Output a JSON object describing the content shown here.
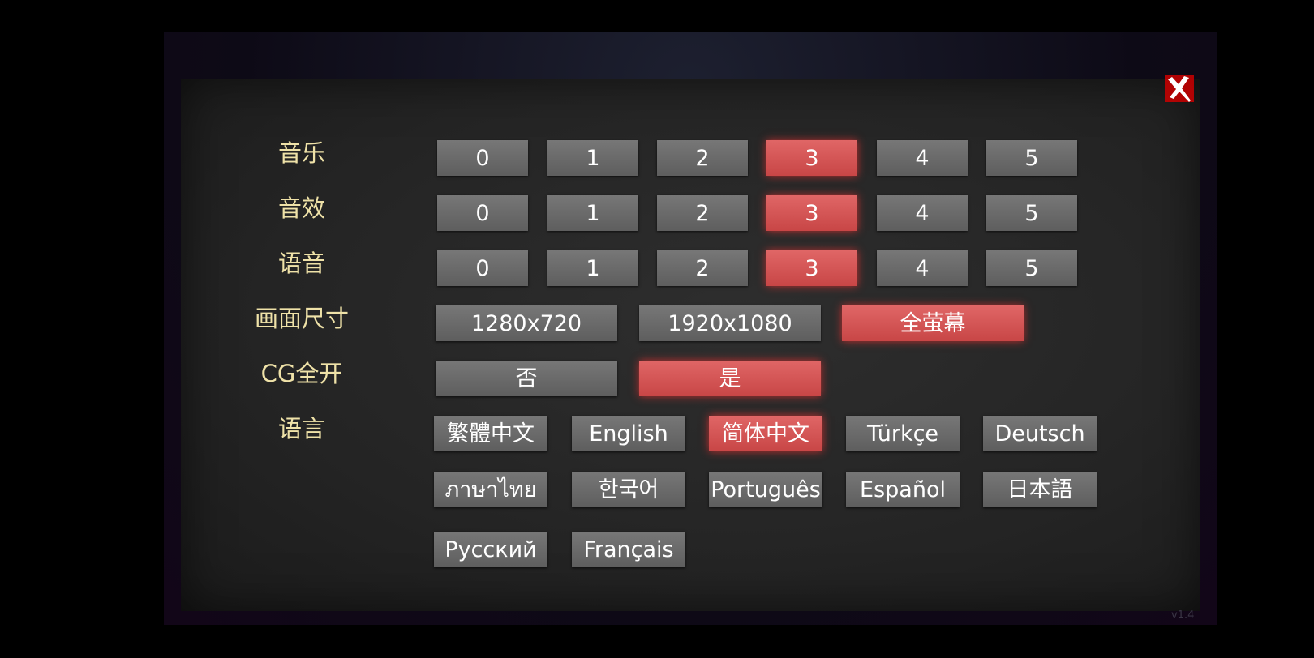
{
  "labels": {
    "music": "音乐",
    "sfx": "音效",
    "voice": "语音",
    "resolution": "画面尺寸",
    "cg": "CG全开",
    "language": "语言"
  },
  "levels": [
    "0",
    "1",
    "2",
    "3",
    "4",
    "5"
  ],
  "music_selected": "3",
  "sfx_selected": "3",
  "voice_selected": "3",
  "resolutions": [
    "1280x720",
    "1920x1080",
    "全萤幕"
  ],
  "resolution_selected": "全萤幕",
  "cg_options": [
    "否",
    "是"
  ],
  "cg_selected": "是",
  "languages": [
    "繁體中文",
    "English",
    "简体中文",
    "Türkçe",
    "Deutsch",
    "ภาษาไทย",
    "한국어",
    "Português",
    "Español",
    "日本語",
    "Русский",
    "Français"
  ],
  "language_selected": "简体中文",
  "version": "v1.4",
  "colors": {
    "selected": "#d65656",
    "button": "#6a6a6a",
    "label": "#efe2a8",
    "close": "#e00000"
  },
  "icons": {
    "close": "close-x-icon"
  }
}
